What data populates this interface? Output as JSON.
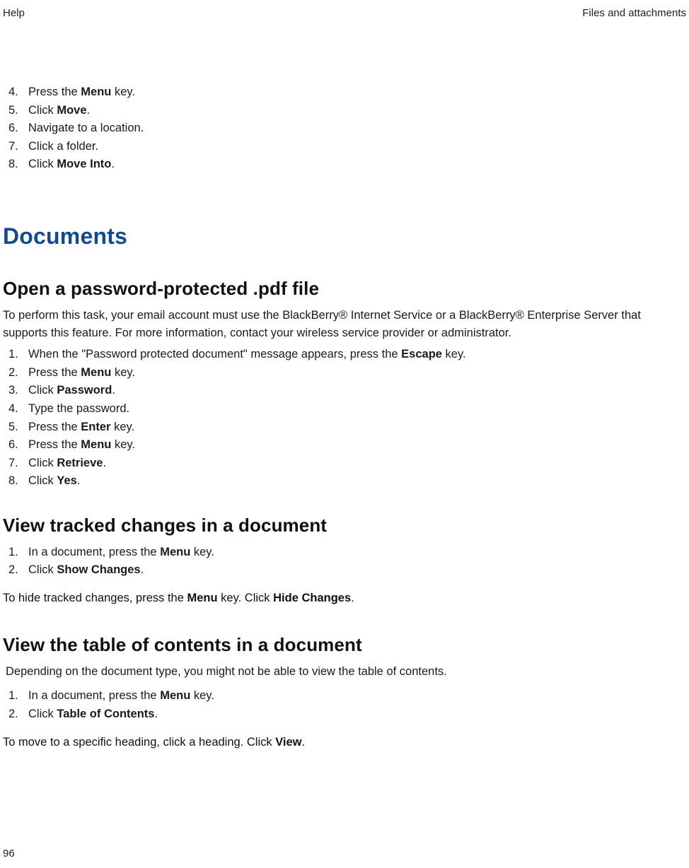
{
  "header": {
    "left": "Help",
    "right": "Files and attachments"
  },
  "intro_steps": [
    {
      "n": "4.",
      "pre": "Press the ",
      "b": "Menu",
      "post": " key."
    },
    {
      "n": "5.",
      "pre": "Click ",
      "b": "Move",
      "post": "."
    },
    {
      "n": "6.",
      "pre": "Navigate to a location.",
      "b": "",
      "post": ""
    },
    {
      "n": "7.",
      "pre": "Click a folder.",
      "b": "",
      "post": ""
    },
    {
      "n": "8.",
      "pre": "Click ",
      "b": "Move Into",
      "post": "."
    }
  ],
  "section_title": "Documents",
  "sub1": {
    "title": "Open a password-protected .pdf file",
    "para": "To perform this task, your email account must use the BlackBerry® Internet Service or a BlackBerry® Enterprise Server that supports this feature. For more information, contact your wireless service provider or administrator.",
    "steps": [
      {
        "n": "1.",
        "pre": "When the \"Password protected document\" message appears, press the ",
        "b": "Escape",
        "post": " key."
      },
      {
        "n": "2.",
        "pre": "Press the ",
        "b": "Menu",
        "post": " key."
      },
      {
        "n": "3.",
        "pre": "Click ",
        "b": "Password",
        "post": "."
      },
      {
        "n": "4.",
        "pre": "Type the password.",
        "b": "",
        "post": ""
      },
      {
        "n": "5.",
        "pre": "Press the ",
        "b": "Enter",
        "post": " key."
      },
      {
        "n": "6.",
        "pre": "Press the ",
        "b": "Menu",
        "post": " key."
      },
      {
        "n": "7.",
        "pre": "Click ",
        "b": "Retrieve",
        "post": "."
      },
      {
        "n": "8.",
        "pre": "Click ",
        "b": "Yes",
        "post": "."
      }
    ]
  },
  "sub2": {
    "title": "View tracked changes in a document",
    "steps": [
      {
        "n": "1.",
        "pre": "In a document, press the ",
        "b": "Menu",
        "post": " key."
      },
      {
        "n": "2.",
        "pre": "Click ",
        "b": "Show Changes",
        "post": "."
      }
    ],
    "after_pre": "To hide tracked changes, press the ",
    "after_b1": "Menu",
    "after_mid": " key. Click ",
    "after_b2": "Hide Changes",
    "after_post": "."
  },
  "sub3": {
    "title": "View the table of contents in a document",
    "para": "Depending on the document type, you might not be able to view the table of contents.",
    "steps": [
      {
        "n": "1.",
        "pre": "In a document, press the ",
        "b": "Menu",
        "post": " key."
      },
      {
        "n": "2.",
        "pre": "Click ",
        "b": "Table of Contents",
        "post": "."
      }
    ],
    "after_pre": "To move to a specific heading, click a heading. Click ",
    "after_b": "View",
    "after_post": "."
  },
  "page_number": "96"
}
